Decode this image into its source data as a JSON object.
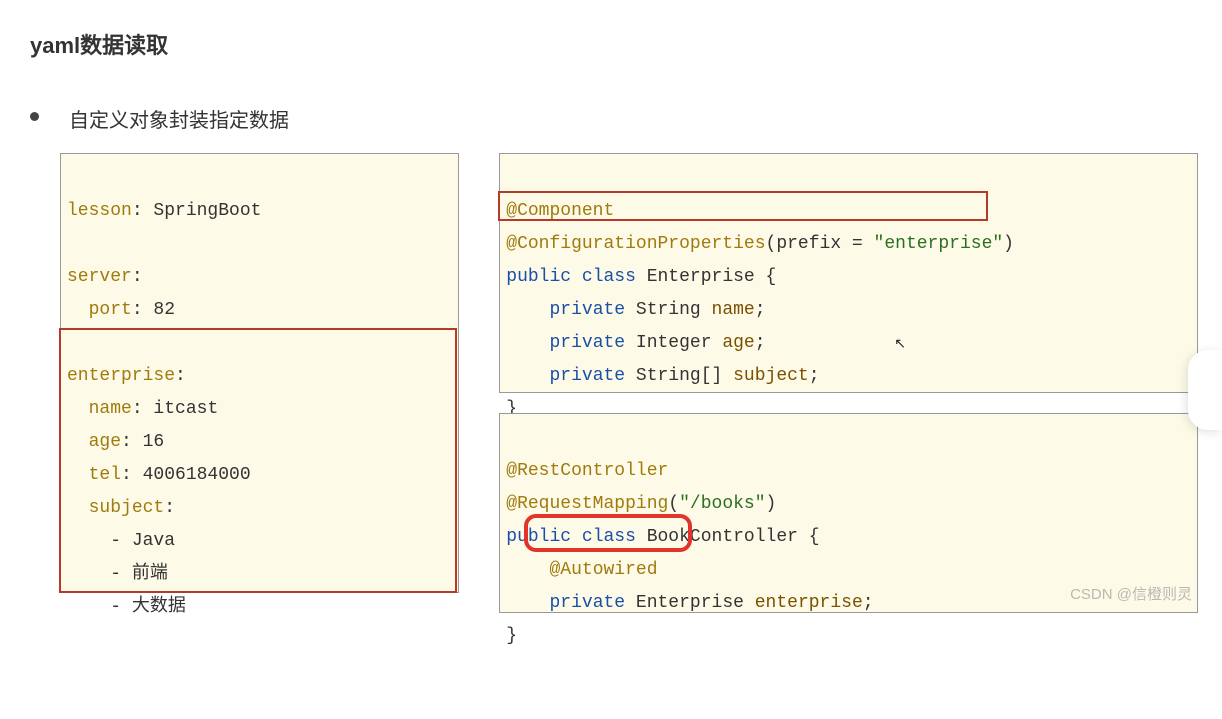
{
  "title": "yaml数据读取",
  "bullet": "自定义对象封装指定数据",
  "yaml": {
    "lesson_key": "lesson",
    "lesson_val": ": SpringBoot",
    "server_key": "server",
    "server_colon": ":",
    "port_key": "port",
    "port_val": ": 82",
    "enterprise_key": "enterprise",
    "enterprise_colon": ":",
    "name_key": "name",
    "name_val": ": itcast",
    "age_key": "age",
    "age_val": ": 16",
    "tel_key": "tel",
    "tel_val": ": 4006184000",
    "subject_key": "subject",
    "subject_colon": ":",
    "subj0": "- Java",
    "subj1": "- 前端",
    "subj2": "- 大数据"
  },
  "java1": {
    "ann_component": "@Component",
    "ann_cfgprops": "@ConfigurationProperties",
    "cfg_open": "(prefix = ",
    "cfg_str": "\"enterprise\"",
    "cfg_close": ")",
    "kw_public": "public ",
    "kw_class": "class",
    "class_name": " Enterprise {",
    "kw_private1": "private ",
    "type_string1": "String ",
    "field_name": "name",
    "semi1": ";",
    "kw_private2": "private ",
    "type_integer": "Integer ",
    "field_age": "age",
    "semi2": ";",
    "kw_private3": "private ",
    "type_stringarr": "String[] ",
    "field_subject": "subject",
    "semi3": ";",
    "close_brace": "}"
  },
  "java2": {
    "ann_rest": "@RestController",
    "ann_reqmap": "@RequestMapping",
    "reqmap_open": "(",
    "reqmap_str": "\"/books\"",
    "reqmap_close": ")",
    "kw_public": "public ",
    "kw_class": "class",
    "class_name": " BookController {",
    "ann_autowired": "@Autowired",
    "kw_private": "private ",
    "type_ent": "Enterprise ",
    "field_ent": "enterprise",
    "semi": ";",
    "close_brace": "}"
  },
  "watermark": "CSDN @信橙则灵"
}
